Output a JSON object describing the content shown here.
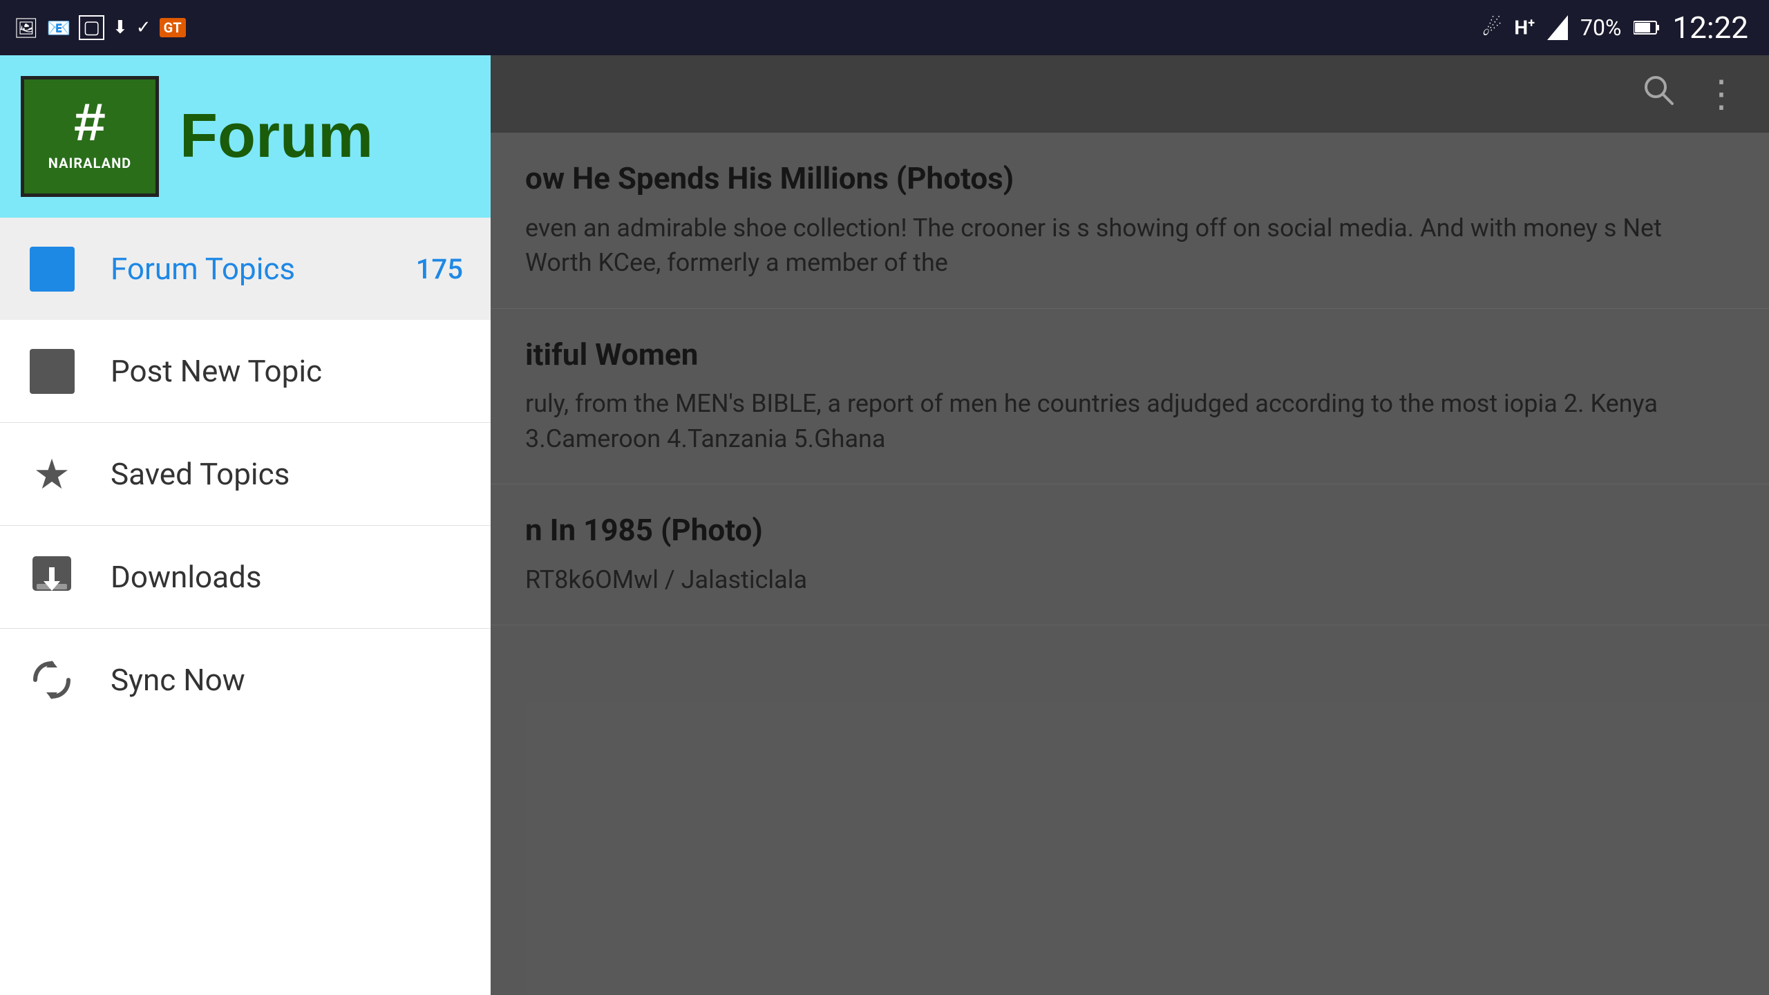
{
  "statusBar": {
    "time": "12:22",
    "battery": "70%",
    "notifIcons": [
      "image",
      "email",
      "window",
      "download",
      "check",
      "gtbank"
    ]
  },
  "header": {
    "logoAlt": "Nairaland Forum Logo",
    "logoHashSymbol": "#",
    "logoBottomText": "NAIRALAND",
    "forumTitle": "Forum"
  },
  "navItems": [
    {
      "id": "forum-topics",
      "label": "Forum Topics",
      "badge": "175",
      "iconType": "blue-square",
      "active": true
    },
    {
      "id": "post-new-topic",
      "label": "Post New Topic",
      "badge": "",
      "iconType": "dark-square",
      "active": false
    },
    {
      "id": "saved-topics",
      "label": "Saved Topics",
      "badge": "",
      "iconType": "star",
      "active": false
    },
    {
      "id": "downloads",
      "label": "Downloads",
      "badge": "",
      "iconType": "download",
      "active": false
    },
    {
      "id": "sync-now",
      "label": "Sync Now",
      "badge": "",
      "iconType": "sync",
      "active": false
    }
  ],
  "contentItems": [
    {
      "title": "ow He Spends His Millions (Photos)",
      "text": "even an admirable shoe collection! The crooner is\ns showing off on social media. And with money\ns Net Worth KCee, formerly a member of the"
    },
    {
      "title": "itiful Women",
      "text": "ruly, from the MEN's BIBLE, a report of men\nhe countries adjudged according to the most\niopia 2. Kenya 3.Cameroon 4.Tanzania 5.Ghana"
    },
    {
      "title": "n In 1985 (Photo)",
      "text": "RT8k6OMwl / Jalasticlala"
    }
  ],
  "appBar": {
    "searchLabel": "Search",
    "moreLabel": "More options"
  }
}
